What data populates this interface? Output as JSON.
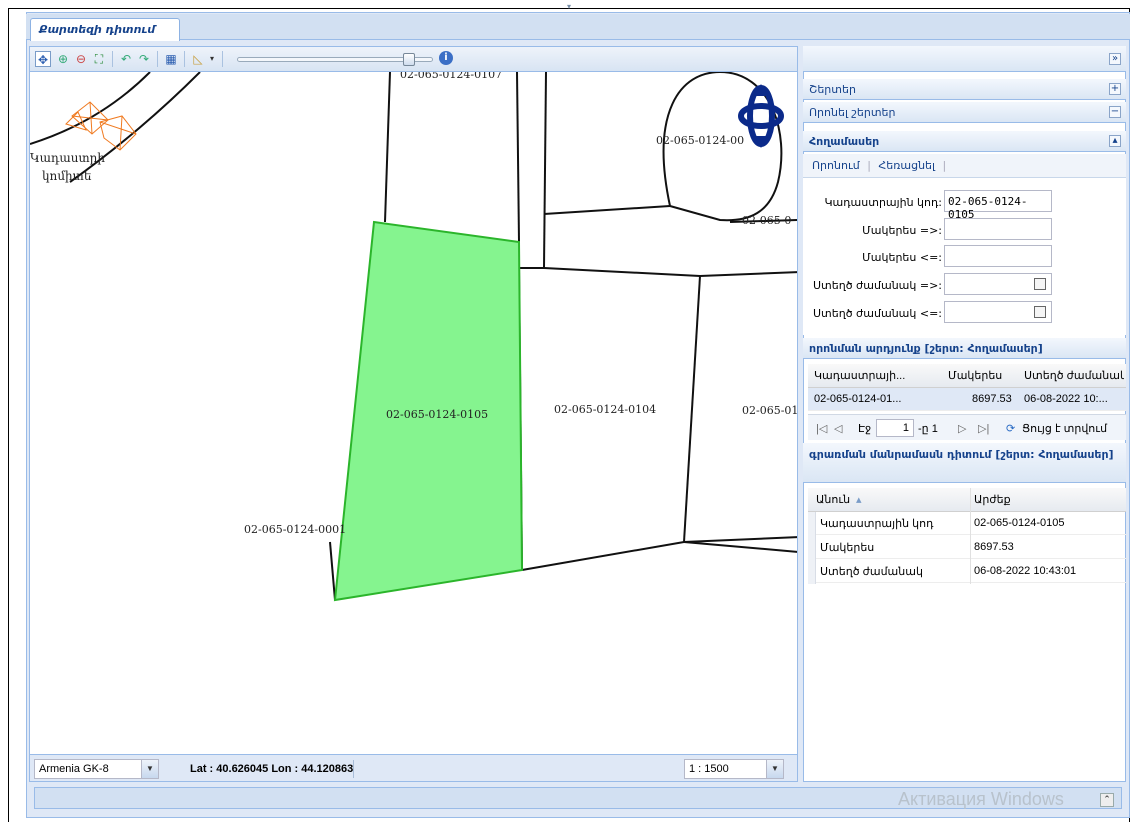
{
  "tab": {
    "label": "Քարտեզի դիտում"
  },
  "map": {
    "parcels": [
      {
        "label": "02-065-0124-0107"
      },
      {
        "label": "02-065-0124-0001"
      },
      {
        "label": "02-065-0124-0105"
      },
      {
        "label": "02-065-0124-0104"
      },
      {
        "label": "02-065-01"
      },
      {
        "label": "02-065-0"
      },
      {
        "label": "02-065-0124-00"
      }
    ],
    "place_label_line1": "Կադաստրի",
    "place_label_line2": "կոմիտե",
    "highlight_color": "#85f48f"
  },
  "status": {
    "projection": "Armenia GK-8",
    "coordinates": "Lat : 40.626045  Lon : 44.120863",
    "scale": "1 : 1500"
  },
  "panel": {
    "layers_title": "Շերտեր",
    "query_layers_title": "Որոնել շերտեր",
    "parcels_title": "Հողամասեր",
    "search_tab": "Որոնում",
    "clear_tab": "Հեռացնել",
    "form": {
      "cadastral_label": "Կադաստրային կոդ:",
      "cadastral_value": "02-065-0124-0105",
      "area_gte_label": "Մակերես =>:",
      "area_lte_label": "Մակերես <=:",
      "created_gte_label": "Ստեղծ ժամանակ =>:",
      "created_lte_label": "Ստեղծ ժամանակ <=:"
    },
    "results_title": "որոնման արդյունք [շերտ: Հողամասեր]",
    "results_cols": [
      "Կադաստրայի...",
      "Մակերես",
      "Ստեղծ ժամանակ..."
    ],
    "results_row": [
      "02-065-0124-01...",
      "8697.53",
      "06-08-2022 10:..."
    ],
    "pager": {
      "page_label": "Էջ",
      "page": "1",
      "of": "-ը 1",
      "display": "Ցույց է տրվում"
    },
    "details_title": "գրառման մանրամասն դիտում [շերտ: Հողամասեր]",
    "details_cols": [
      "Անուն",
      "Արժեք"
    ],
    "details_rows": [
      {
        "name": "Կադաստրային կոդ",
        "value": "02-065-0124-0105"
      },
      {
        "name": "Մակերես",
        "value": "8697.53"
      },
      {
        "name": "Ստեղծ ժամանակ",
        "value": "06-08-2022 10:43:01"
      }
    ]
  },
  "watermark": "Активация Windows"
}
